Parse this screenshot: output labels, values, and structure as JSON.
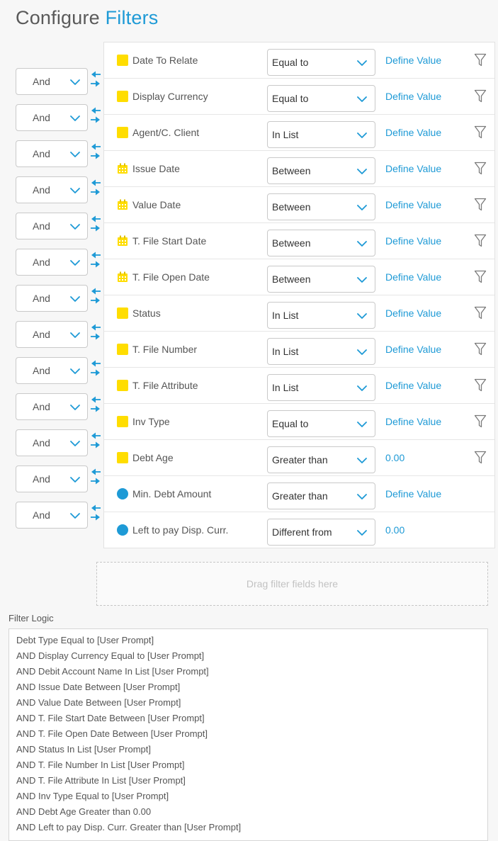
{
  "header": {
    "title_main": "Configure",
    "title_accent": "Filters"
  },
  "operators": [
    "And",
    "And",
    "And",
    "And",
    "And",
    "And",
    "And",
    "And",
    "And",
    "And",
    "And",
    "And",
    "And"
  ],
  "filters": [
    {
      "name": "Date To Relate",
      "icon": "square",
      "condition": "Equal to",
      "value": "Define Value",
      "funnel": true
    },
    {
      "name": "Display Currency",
      "icon": "square",
      "condition": "Equal to",
      "value": "Define Value",
      "funnel": true
    },
    {
      "name": "Agent/C. Client",
      "icon": "square",
      "condition": "In List",
      "value": "Define Value",
      "funnel": true
    },
    {
      "name": "Issue Date",
      "icon": "calendar",
      "condition": "Between",
      "value": "Define Value",
      "funnel": true
    },
    {
      "name": "Value Date",
      "icon": "calendar",
      "condition": "Between",
      "value": "Define Value",
      "funnel": true
    },
    {
      "name": "T. File Start Date",
      "icon": "calendar",
      "condition": "Between",
      "value": "Define Value",
      "funnel": true
    },
    {
      "name": "T. File Open Date",
      "icon": "calendar",
      "condition": "Between",
      "value": "Define Value",
      "funnel": true
    },
    {
      "name": "Status",
      "icon": "square",
      "condition": "In List",
      "value": "Define Value",
      "funnel": true
    },
    {
      "name": "T. File Number",
      "icon": "square",
      "condition": "In List",
      "value": "Define Value",
      "funnel": true
    },
    {
      "name": "T. File Attribute",
      "icon": "square",
      "condition": "In List",
      "value": "Define Value",
      "funnel": true
    },
    {
      "name": "Inv Type",
      "icon": "square",
      "condition": "Equal to",
      "value": "Define Value",
      "funnel": true
    },
    {
      "name": "Debt Age",
      "icon": "square",
      "condition": "Greater than",
      "value": "0.00",
      "funnel": true
    },
    {
      "name": "Min. Debt Amount",
      "icon": "circle",
      "condition": "Greater than",
      "value": "Define Value",
      "funnel": false
    },
    {
      "name": "Left to pay Disp. Curr.",
      "icon": "circle",
      "condition": "Different from",
      "value": "0.00",
      "funnel": false
    }
  ],
  "dropzone": {
    "text": "Drag filter fields here"
  },
  "filter_logic": {
    "label": "Filter Logic",
    "lines": [
      "Debt Type Equal to [User Prompt]",
      "AND Display Currency Equal to [User Prompt]",
      "AND Debit Account Name In List [User Prompt]",
      "AND Issue Date Between [User Prompt]",
      "AND Value Date Between [User Prompt]",
      "AND T. File Start Date Between [User Prompt]",
      "AND T. File Open Date Between [User Prompt]",
      "AND Status In List [User Prompt]",
      "AND T. File Number In List [User Prompt]",
      "AND T. File Attribute In List [User Prompt]",
      "AND Inv Type Equal to [User Prompt]",
      "AND Debt Age Greater than 0.00",
      "AND Left to pay Disp. Curr. Greater than [User Prompt]"
    ]
  },
  "colors": {
    "accent": "#1e9ad6",
    "field_yellow": "#ffdd00",
    "field_blue": "#1e9ad6"
  }
}
